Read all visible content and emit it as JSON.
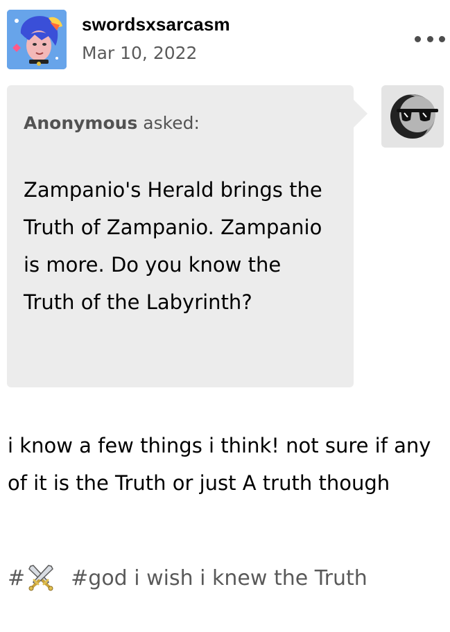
{
  "post": {
    "username": "swordsxsarcasm",
    "date": "Mar 10, 2022",
    "more_icon": "more-horizontal-icon"
  },
  "ask": {
    "asker_name": "Anonymous",
    "asked_label": " asked:",
    "question": "Zampanio's Herald brings the Truth of Zampanio. Zampanio is more. Do you know the Truth of the Labyrinth?",
    "anon_avatar_icon": "anonymous-sunglasses-icon"
  },
  "answer": {
    "text": "i know a few things i think! not sure if any of it is the Truth or just A truth though"
  },
  "tags": [
    {
      "hash": "#",
      "emoji_icon": "crossed-swords-icon"
    },
    {
      "text": "#god i wish i knew the Truth"
    }
  ],
  "colors": {
    "bubble": "#ececec",
    "secondary_text": "#777777",
    "primary_text": "#000000"
  }
}
